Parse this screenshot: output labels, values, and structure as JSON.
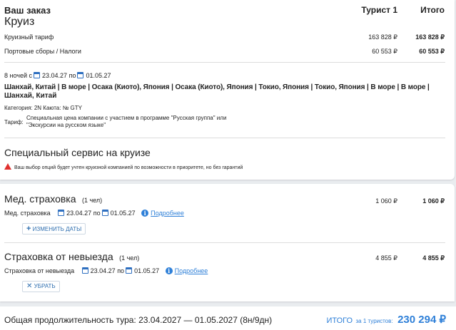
{
  "order": {
    "label": "Ваш заказ",
    "title": "Круиз",
    "col_tourist": "Турист 1",
    "col_total": "Итого",
    "lines": [
      {
        "label": "Круизный тариф",
        "tourist": "163 828 ₽",
        "total": "163 828 ₽"
      },
      {
        "label": "Портовые сборы / Налоги",
        "tourist": "60 553 ₽",
        "total": "60 553 ₽"
      }
    ],
    "nights_prefix": "8 ночей с",
    "date_from": "23.04.27",
    "date_sep": "по",
    "date_to": "01.05.27",
    "route_line1": "Шанхай, Китай | В море | Осака (Киото), Япония | Осака (Киото), Япония | Токио, Япония | Токио, Япония | В море | В море |",
    "route_line2": "Шанхай, Китай",
    "category_line": "Категория: 2N   Каюта: № GTY",
    "tariff_label": "Тариф:",
    "tariff_text1": "Специальная цена компании с участием в программе \"Русская группа\" или",
    "tariff_text2": "\"Экскурсии на русском языке\""
  },
  "special_service": {
    "title": "Специальный сервис на круизе",
    "warning": "Ваш выбор опций будет учтен круизной компанией по возможности в приоритете, но без гарантий"
  },
  "insurance_med": {
    "title": "Мед. страховка",
    "count": "(1 чел)",
    "tourist": "1 060 ₽",
    "total": "1 060 ₽",
    "label": "Мед. страховка",
    "date_from": "23.04.27",
    "date_sep": "по",
    "date_to": "01.05.27",
    "details_link": "Подробнее",
    "button": "ИЗМЕНИТЬ ДАТЫ"
  },
  "insurance_cancel": {
    "title": "Страховка от невыезда",
    "count": "(1 чел)",
    "tourist": "4 855 ₽",
    "total": "4 855 ₽",
    "label": "Страховка от невыезда",
    "date_from": "23.04.27",
    "date_sep": "по",
    "date_to": "01.05.27",
    "details_link": "Подробнее",
    "button": "УБРАТЬ"
  },
  "footer": {
    "duration": "Общая продолжительность тура: 23.04.2027 — 01.05.2027 (8н/9дн)",
    "total_label": "ИТОГО",
    "total_note": "за 1 туристов:",
    "total_value": "230 294 ₽"
  },
  "icons": [
    "calendar-icon",
    "info-icon",
    "plus-icon",
    "close-icon",
    "warning-icon"
  ],
  "colors": {
    "accent": "#2f80d8",
    "warning": "#e0302e"
  }
}
